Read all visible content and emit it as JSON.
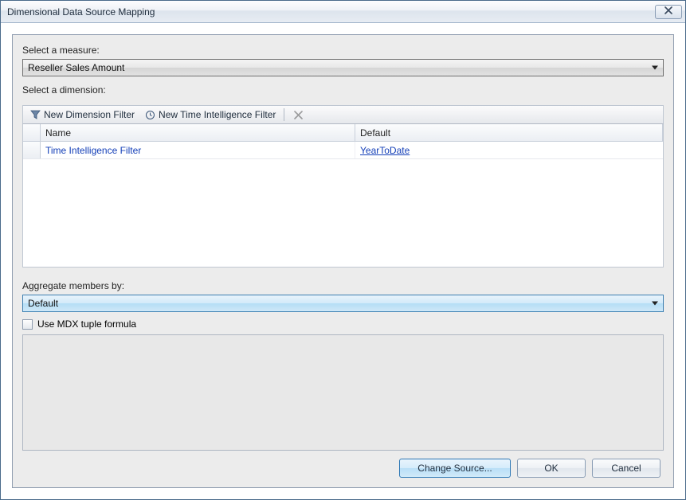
{
  "window": {
    "title": "Dimensional Data Source Mapping"
  },
  "measure": {
    "label": "Select a measure:",
    "value": "Reseller Sales Amount"
  },
  "dimension": {
    "label": "Select a dimension:",
    "toolbar": {
      "new_dim": "New Dimension Filter",
      "new_time": "New Time Intelligence Filter"
    },
    "columns": {
      "name": "Name",
      "default": "Default"
    },
    "rows": [
      {
        "name": "Time Intelligence Filter",
        "default": "YearToDate"
      }
    ]
  },
  "aggregate": {
    "label": "Aggregate members by:",
    "value": "Default"
  },
  "mdx": {
    "checkbox_label": "Use MDX tuple formula"
  },
  "buttons": {
    "change_source": "Change Source...",
    "ok": "OK",
    "cancel": "Cancel"
  }
}
